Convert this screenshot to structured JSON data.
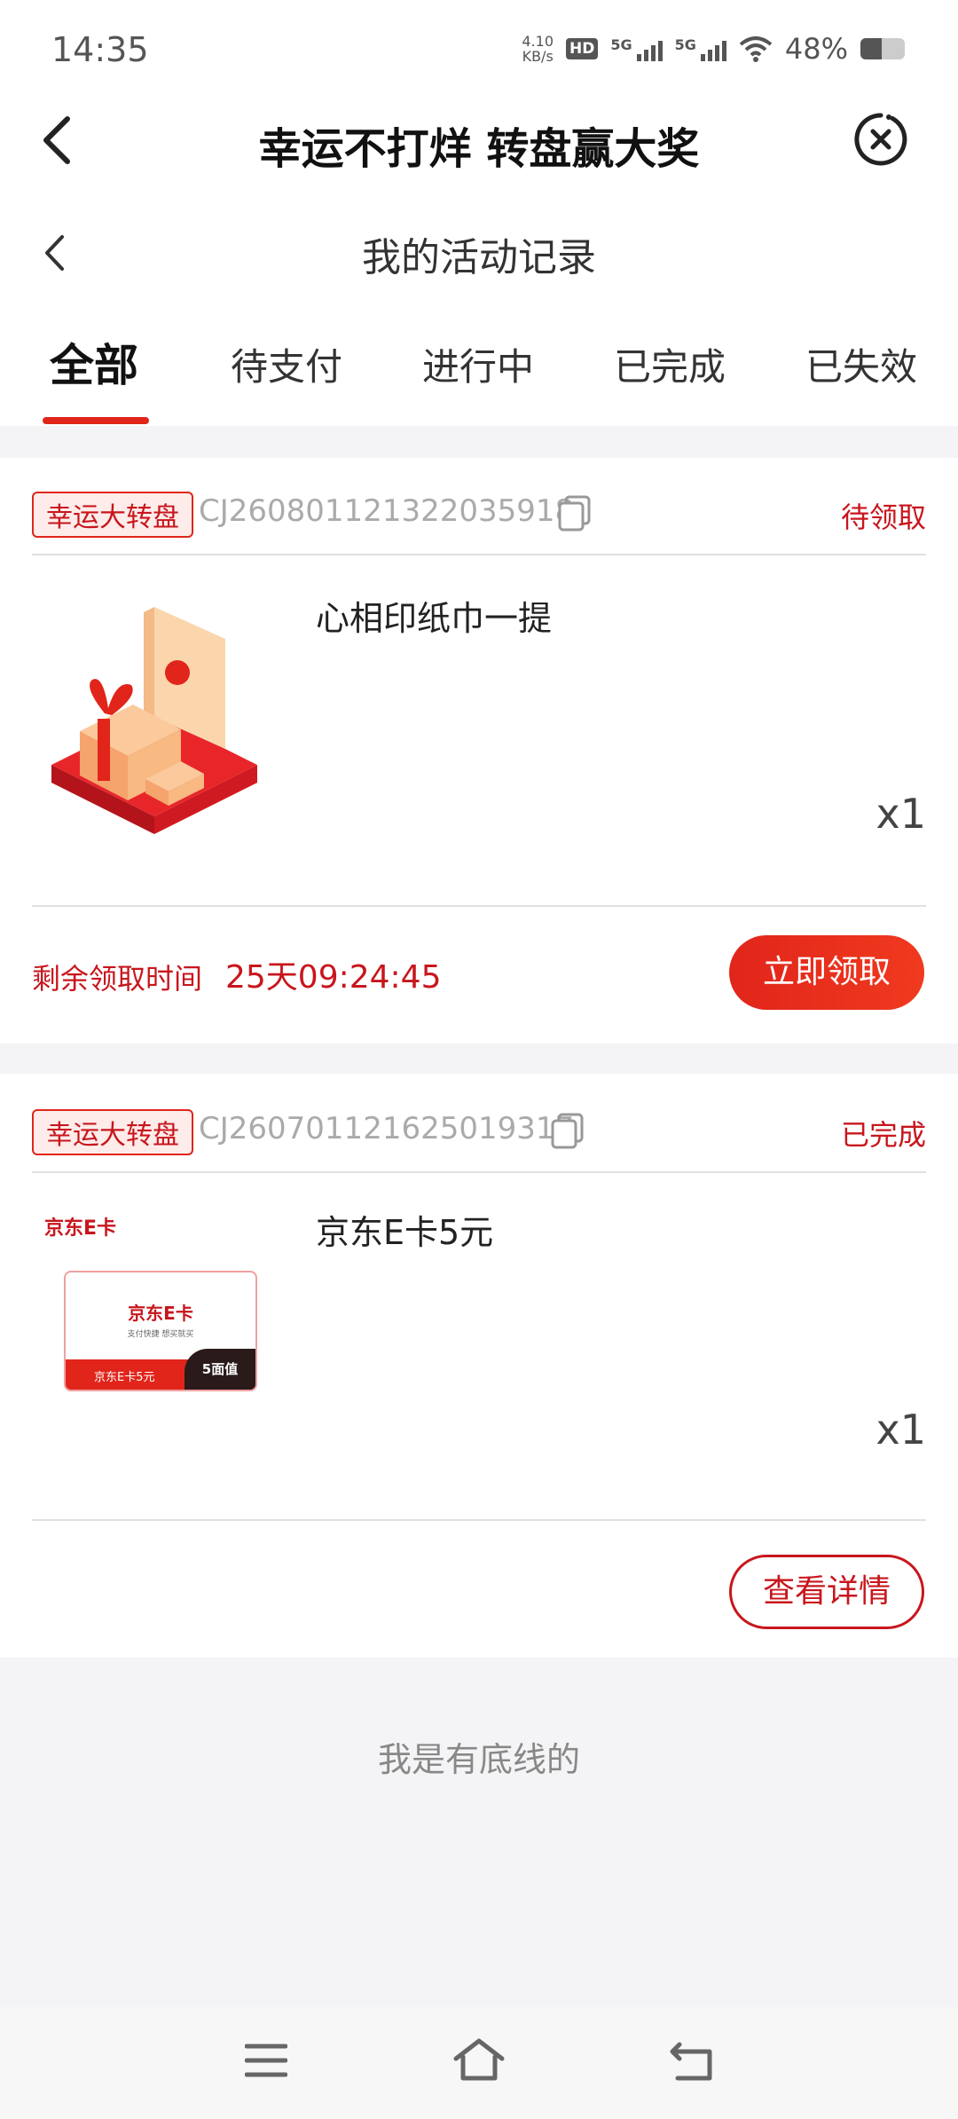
{
  "status_bar": {
    "time": "14:35",
    "net_speed_value": "4.10",
    "net_speed_unit": "KB/s",
    "hd": "HD",
    "sim1": "5G",
    "sim2": "5G",
    "battery": "48%"
  },
  "header": {
    "title": "幸运不打烊 转盘赢大奖",
    "back_icon": "chevron-left-icon",
    "close_icon": "close-circle-icon"
  },
  "subheader": {
    "title": "我的活动记录"
  },
  "tabs": [
    {
      "label": "全部",
      "active": true
    },
    {
      "label": "待支付",
      "active": false
    },
    {
      "label": "进行中",
      "active": false
    },
    {
      "label": "已完成",
      "active": false
    },
    {
      "label": "已失效",
      "active": false
    }
  ],
  "records": [
    {
      "tag": "幸运大转盘",
      "order_no": "CJ260801121322035918",
      "status": "待领取",
      "product_name": "心相印纸巾一提",
      "qty": "x1",
      "countdown_label": "剩余领取时间",
      "countdown_value": "25天09:24:45",
      "action": "立即领取"
    },
    {
      "tag": "幸运大转盘",
      "order_no": "CJ260701121625019317",
      "status": "已完成",
      "product_name": "京东E卡5元",
      "qty": "x1",
      "card_brand": "京东E卡",
      "card_title": "京东E卡",
      "card_slogan": "支付快捷 想买就买",
      "card_bottom_label": "京东E卡5元",
      "card_value_badge": "5面值",
      "action": "查看详情"
    }
  ],
  "footer": {
    "text": "我是有底线的"
  },
  "colors": {
    "accent": "#e1251b",
    "status_red": "#c8161d",
    "background": "#f4f4f6"
  }
}
